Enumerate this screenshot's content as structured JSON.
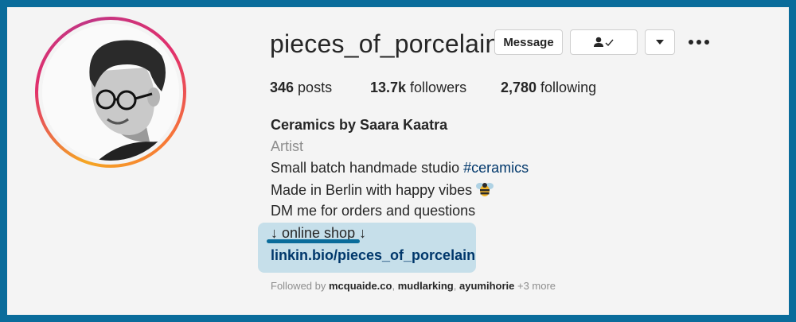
{
  "profile": {
    "username": "pieces_of_porcelain",
    "avatar_icon": "profile-photo"
  },
  "actions": {
    "message_label": "Message",
    "following_icon": "person-check-icon",
    "dropdown_icon": "caret-down-icon",
    "more_icon": "ellipsis-icon"
  },
  "stats": {
    "posts_count": "346",
    "posts_label": " posts",
    "followers_count": "13.7k",
    "followers_label": " followers",
    "following_count": "2,780",
    "following_label": " following"
  },
  "bio": {
    "full_name": "Ceramics by Saara Kaatra",
    "category": "Artist",
    "line1_text": "Small batch handmade studio ",
    "line1_hashtag": "#ceramics",
    "line2_text": "Made in Berlin with happy vibes ",
    "line2_emoji": "bee-emoji",
    "line3_text": "DM me for orders and questions",
    "shop_label": "↓ online shop ↓",
    "link": "linkin.bio/pieces_of_porcelain"
  },
  "followed_by": {
    "prefix": "Followed by ",
    "users": [
      "mcquaide.co",
      "mudlarking",
      "ayumihorie"
    ],
    "sep": ", ",
    "more": " +3 more"
  },
  "colors": {
    "border_frame": "#0a6c9b",
    "highlight": "#c6dfea",
    "link": "#00376b"
  }
}
